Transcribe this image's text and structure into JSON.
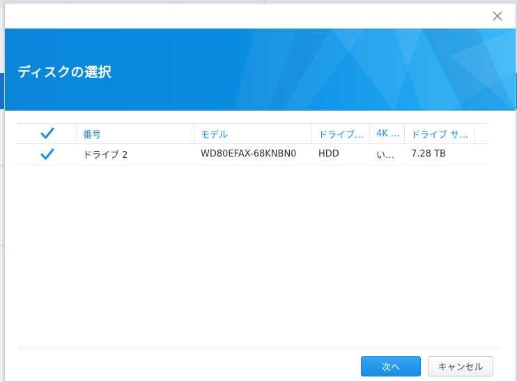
{
  "dialog": {
    "title": "ディスクの選択",
    "close_icon": "close-icon"
  },
  "table": {
    "select_all_checked": true,
    "headers": {
      "number": "番号",
      "model": "モデル",
      "drive_type": "ドライブ…",
      "four_k": "4K …",
      "drive_size": "ドライブ サ…"
    },
    "rows": [
      {
        "checked": true,
        "number": "ドライブ 2",
        "model": "WD80EFAX-68KNBN0",
        "drive_type": "HDD",
        "four_k": "い…",
        "drive_size": "7.28 TB"
      }
    ]
  },
  "footer": {
    "next_label": "次へ",
    "cancel_label": "キャンセル"
  },
  "colors": {
    "accent": "#1a8ee8",
    "banner": "#0a86d9"
  }
}
